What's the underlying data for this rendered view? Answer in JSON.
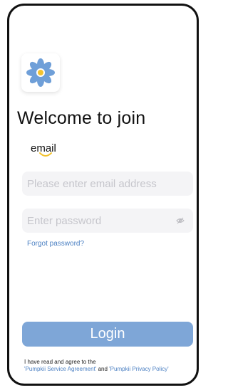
{
  "header": {
    "title": "Welcome to join"
  },
  "tabs": {
    "active_label": "email"
  },
  "form": {
    "email": {
      "value": "",
      "placeholder": "Please enter email address"
    },
    "password": {
      "value": "",
      "placeholder": "Enter password"
    },
    "forgot_label": "Forgot password?",
    "login_label": "Login"
  },
  "agreement": {
    "prefix": "I have read and agree to the",
    "service_link": "'Pumpkii Service Agreement'",
    "and_text": "and",
    "privacy_link": "'Pumpkii Privacy Policy'"
  },
  "icons": {
    "logo": "flower-logo-icon",
    "password_visibility": "eye-closed-icon"
  },
  "colors": {
    "primary": "#7ea6d7",
    "link": "#4a7fc2",
    "accent_underline": "#f2c230",
    "field_background": "#f4f4f6"
  }
}
